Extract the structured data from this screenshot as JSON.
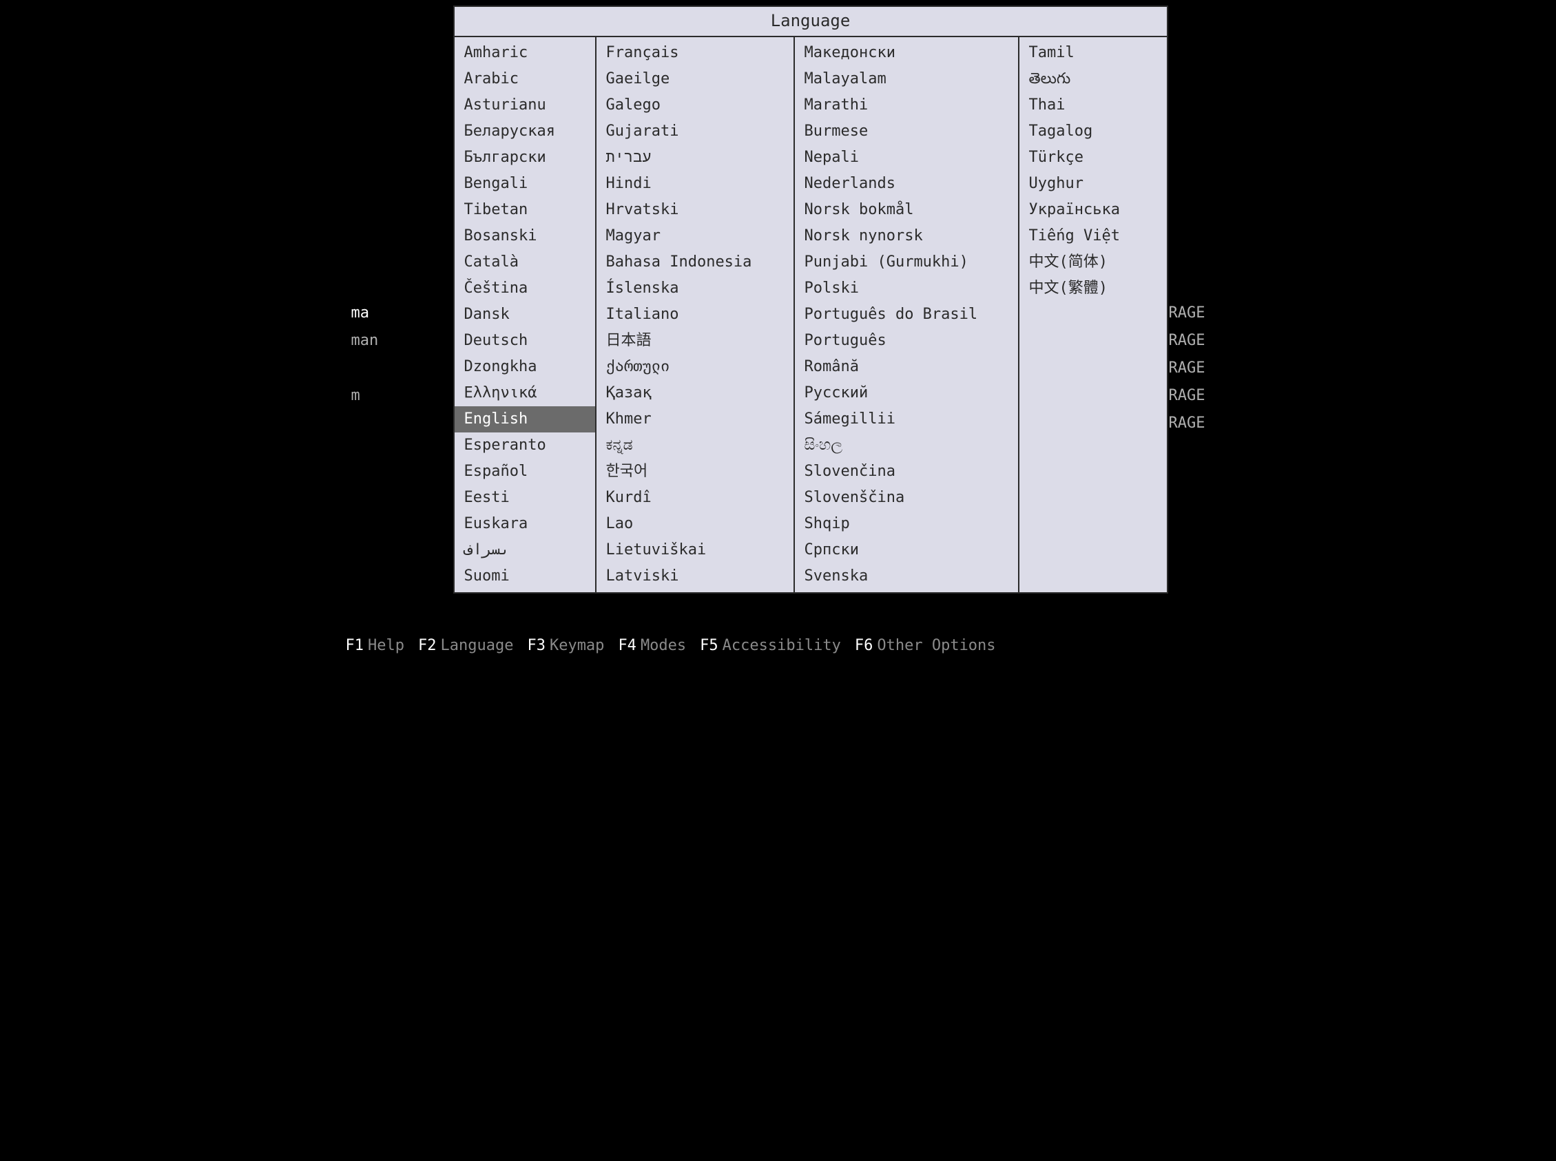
{
  "dialog": {
    "title": "Language",
    "selected": "English",
    "columns": [
      [
        "Amharic",
        "Arabic",
        "Asturianu",
        "Беларуская",
        "Български",
        "Bengali",
        "Tibetan",
        "Bosanski",
        "Català",
        "Čeština",
        "Dansk",
        "Deutsch",
        "Dzongkha",
        "Ελληνικά",
        "English",
        "Esperanto",
        "Español",
        "Eesti",
        "Euskara",
        "ىسراف",
        "Suomi"
      ],
      [
        "Français",
        "Gaeilge",
        "Galego",
        "Gujarati",
        "עברית",
        "Hindi",
        "Hrvatski",
        "Magyar",
        "Bahasa Indonesia",
        "Íslenska",
        "Italiano",
        "日本語",
        "ქართული",
        "Қазақ",
        "Khmer",
        "ಕನ್ನಡ",
        "한국어",
        "Kurdî",
        "Lao",
        "Lietuviškai",
        "Latviski"
      ],
      [
        "Македонски",
        "Malayalam",
        "Marathi",
        "Burmese",
        "Nepali",
        "Nederlands",
        "Norsk bokmål",
        "Norsk nynorsk",
        "Punjabi (Gurmukhi)",
        "Polski",
        "Português do Brasil",
        "Português",
        "Română",
        "Русский",
        "Sámegillii",
        "සිංහල",
        "Slovenčina",
        "Slovenščina",
        "Shqip",
        "Српски",
        "Svenska"
      ],
      [
        "Tamil",
        "తెలుగు",
        "Thai",
        "Tagalog",
        "Türkçe",
        "Uyghur",
        "Українська",
        "Tiếng Việt",
        "中文(简体)",
        "中文(繁體)"
      ]
    ]
  },
  "background": {
    "lines": [
      {
        "left": "ma",
        "right": "D STORAGE",
        "leftHighlight": true
      },
      {
        "left": "man",
        "right": "GB STORAGE"
      },
      {
        "left": "",
        "right": "TORAGE"
      },
      {
        "left": "m",
        "right": " STORAGE"
      },
      {
        "left": "",
        "right": "TORAGE"
      }
    ]
  },
  "fkeys": [
    {
      "key": "F1",
      "label": "Help"
    },
    {
      "key": "F2",
      "label": "Language"
    },
    {
      "key": "F3",
      "label": "Keymap"
    },
    {
      "key": "F4",
      "label": "Modes"
    },
    {
      "key": "F5",
      "label": "Accessibility"
    },
    {
      "key": "F6",
      "label": "Other Options"
    }
  ]
}
